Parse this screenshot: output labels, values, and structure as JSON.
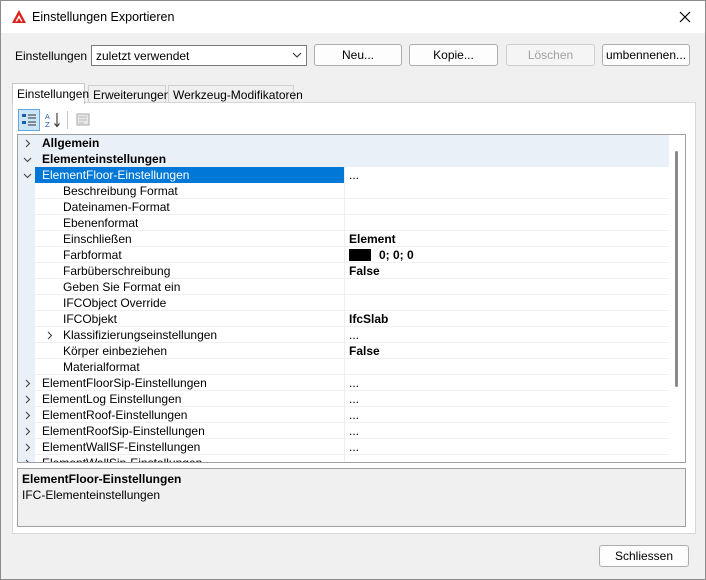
{
  "window": {
    "title": "Einstellungen Exportieren"
  },
  "settings": {
    "label": "Einstellungen",
    "combo_value": "zuletzt verwendet",
    "buttons": {
      "new": "Neu...",
      "copy": "Kopie...",
      "delete": "Löschen",
      "rename": "umbennenen..."
    }
  },
  "tabs": [
    "Einstellungen",
    "Erweiterungen",
    "Werkzeug-Modifikatoren"
  ],
  "grid": {
    "rows": [
      {
        "name": "Allgemein",
        "value": ""
      },
      {
        "name": "Elementeinstellungen",
        "value": ""
      },
      {
        "name": "ElementFloor-Einstellungen",
        "value": "..."
      },
      {
        "name": "Beschreibung Format",
        "value": ""
      },
      {
        "name": "Dateinamen-Format",
        "value": ""
      },
      {
        "name": "Ebenenformat",
        "value": ""
      },
      {
        "name": "Einschließen",
        "value": "Element"
      },
      {
        "name": "Farbformat",
        "value": "0; 0; 0"
      },
      {
        "name": "Farbüberschreibung",
        "value": "False"
      },
      {
        "name": "Geben Sie Format ein",
        "value": ""
      },
      {
        "name": "IFCObject Override",
        "value": ""
      },
      {
        "name": "IFCObjekt",
        "value": "IfcSlab"
      },
      {
        "name": "Klassifizierungseinstellungen",
        "value": "..."
      },
      {
        "name": "Körper einbeziehen",
        "value": "False"
      },
      {
        "name": "Materialformat",
        "value": ""
      },
      {
        "name": "ElementFloorSip-Einstellungen",
        "value": "..."
      },
      {
        "name": "ElementLog Einstellungen",
        "value": "..."
      },
      {
        "name": "ElementRoof-Einstellungen",
        "value": "..."
      },
      {
        "name": "ElementRoofSip-Einstellungen",
        "value": "..."
      },
      {
        "name": "ElementWallSF-Einstellungen",
        "value": "..."
      },
      {
        "name": "ElementWallSip-Einstellungen",
        "value": ""
      }
    ]
  },
  "description": {
    "title": "ElementFloor-Einstellungen",
    "text": "IFC-Elementeinstellungen"
  },
  "footer": {
    "close": "Schliessen"
  },
  "colors": {
    "selection": "#0078d7",
    "category_bg": "#eaf0f7",
    "swatch": "#000000"
  }
}
